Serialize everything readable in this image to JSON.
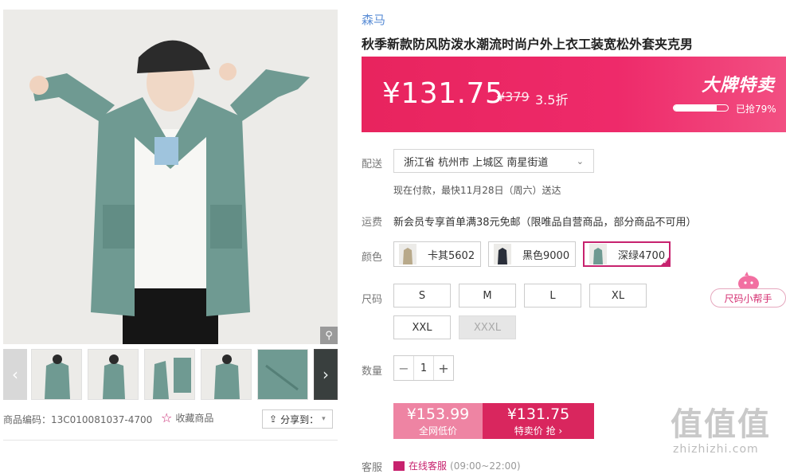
{
  "product": {
    "brand": "森马",
    "title": "秋季新款防风防泼水潮流时尚户外上衣工装宽松外套夹克男",
    "code_label": "商品编码：13C010081037-4700",
    "favorite_label": "收藏商品",
    "share_label": "分享到："
  },
  "price": {
    "current": "¥131.75",
    "original": "¥379",
    "discount": "3.5折",
    "promo_title": "大牌特卖",
    "sold_fraction": 0.79,
    "sold_text": "已抢79%"
  },
  "delivery": {
    "label": "配送",
    "address": "浙江省 杭州市 上城区 南星街道",
    "eta": "现在付款，最快11月28日（周六）送达"
  },
  "shipping": {
    "label": "运费",
    "text": "新会员专享首单满38元免邮（限唯品自营商品，部分商品不可用）"
  },
  "colors": {
    "label": "颜色",
    "options": [
      {
        "name": "卡其5602",
        "swatch": "#b8a98a",
        "selected": false
      },
      {
        "name": "黑色9000",
        "swatch": "#2a2f3a",
        "selected": false
      },
      {
        "name": "深绿4700",
        "swatch": "#6f9a92",
        "selected": true
      }
    ]
  },
  "sizes": {
    "label": "尺码",
    "options": [
      {
        "name": "S",
        "available": true
      },
      {
        "name": "M",
        "available": true
      },
      {
        "name": "L",
        "available": true
      },
      {
        "name": "XL",
        "available": true
      },
      {
        "name": "XXL",
        "available": true
      },
      {
        "name": "XXXL",
        "available": false
      }
    ],
    "helper_label": "尺码小帮手"
  },
  "quantity": {
    "label": "数量",
    "value": "1",
    "minus": "−",
    "plus": "+"
  },
  "buy": {
    "left_price": "¥153.99",
    "left_label": "全网低价",
    "right_price": "¥131.75",
    "right_label": "特卖价 抢 ›"
  },
  "footer": {
    "service_label": "客服",
    "service_text": "在线客服",
    "service_hours": "(09:00~22:00)"
  },
  "watermark": {
    "main": "值值值",
    "sub": "zhizhizhi.com"
  },
  "colors_theme": {
    "accent": "#e8245e",
    "brand_link": "#5b8ed6",
    "selected_border": "#c7226e"
  }
}
